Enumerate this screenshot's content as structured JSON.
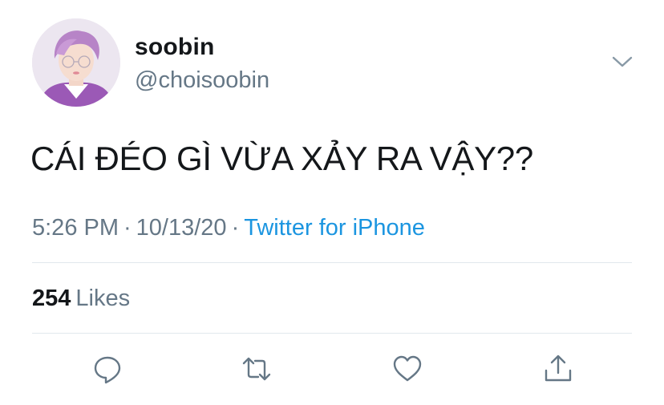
{
  "user": {
    "display_name": "soobin",
    "handle": "@choisoobin"
  },
  "tweet": {
    "text": "CÁI ĐÉO GÌ VỪA XẢY RA VẬY??",
    "time": "5:26 PM",
    "date": "10/13/20",
    "source": "Twitter for iPhone",
    "separator": "·"
  },
  "stats": {
    "likes_count": "254",
    "likes_label": "Likes"
  },
  "icons": {
    "menu": "chevron-down-icon",
    "reply": "reply-icon",
    "retweet": "retweet-icon",
    "like": "heart-icon",
    "share": "share-icon"
  },
  "colors": {
    "text_primary": "#14171a",
    "text_secondary": "#657786",
    "link": "#1b95e0",
    "divider": "#e1e8ed"
  }
}
